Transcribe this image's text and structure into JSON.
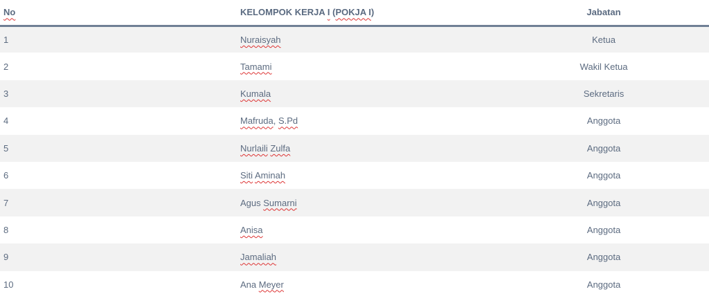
{
  "table": {
    "headers": {
      "no": "No",
      "name_prefix": "KELOMPOK KERJA ",
      "name_roman": "I",
      "name_paren_open": " (",
      "name_pokja": "POKJA I",
      "name_paren_close": ")",
      "jabatan": "Jabatan"
    },
    "rows": [
      {
        "no": "1",
        "name_parts": [
          {
            "t": "Nuraisyah",
            "spell": true
          }
        ],
        "jabatan": "Ketua"
      },
      {
        "no": "2",
        "name_parts": [
          {
            "t": "Tamami",
            "spell": true
          }
        ],
        "jabatan": "Wakil Ketua"
      },
      {
        "no": "3",
        "name_parts": [
          {
            "t": "Kumala",
            "spell": true
          }
        ],
        "jabatan": "Sekretaris"
      },
      {
        "no": "4",
        "name_parts": [
          {
            "t": "Mafruda",
            "spell": true
          },
          {
            "t": ", ",
            "spell": false
          },
          {
            "t": "S.Pd",
            "spell": true
          }
        ],
        "jabatan": "Anggota"
      },
      {
        "no": "5",
        "name_parts": [
          {
            "t": "Nurlaili",
            "spell": true
          },
          {
            "t": " ",
            "spell": false
          },
          {
            "t": "Zulfa",
            "spell": true
          }
        ],
        "jabatan": "Anggota"
      },
      {
        "no": "6",
        "name_parts": [
          {
            "t": "Siti",
            "spell": true
          },
          {
            "t": " ",
            "spell": false
          },
          {
            "t": "Aminah",
            "spell": true
          }
        ],
        "jabatan": "Anggota"
      },
      {
        "no": "7",
        "name_parts": [
          {
            "t": "Agus ",
            "spell": false
          },
          {
            "t": "Sumarni",
            "spell": true
          }
        ],
        "jabatan": "Anggota"
      },
      {
        "no": "8",
        "name_parts": [
          {
            "t": "Anisa",
            "spell": true
          }
        ],
        "jabatan": "Anggota"
      },
      {
        "no": "9",
        "name_parts": [
          {
            "t": "Jamaliah",
            "spell": true
          }
        ],
        "jabatan": "Anggota"
      },
      {
        "no": "10",
        "name_parts": [
          {
            "t": "Ana ",
            "spell": false
          },
          {
            "t": "Meyer",
            "spell": true
          }
        ],
        "jabatan": "Anggota"
      }
    ]
  },
  "colors": {
    "text": "#5c6b80",
    "header_rule": "#6f7f95",
    "stripe": "#f2f2f2",
    "spellcheck": "#dd3333"
  }
}
